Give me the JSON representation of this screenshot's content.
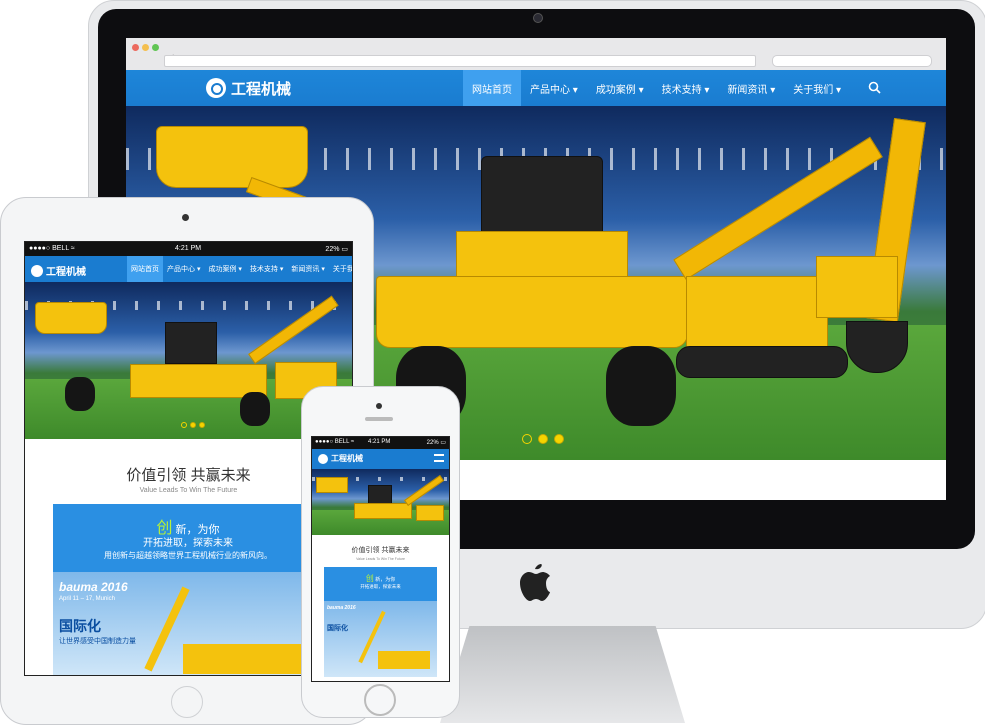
{
  "desktop": {
    "logo_text": "工程机械",
    "nav": [
      {
        "label": "网站首页",
        "active": true
      },
      {
        "label": "产品中心 ▾",
        "active": false
      },
      {
        "label": "成功案例 ▾",
        "active": false
      },
      {
        "label": "技术支持 ▾",
        "active": false
      },
      {
        "label": "新闻资讯 ▾",
        "active": false
      },
      {
        "label": "关于我们 ▾",
        "active": false
      }
    ],
    "carousel": {
      "count": 3,
      "active_index": 0
    },
    "colors": {
      "brand_blue": "#1a7cd0",
      "active_blue": "#3fa0ef",
      "machine_yellow": "#f4c20d"
    }
  },
  "tablet": {
    "status": {
      "carrier": "●●●●○ BELL ≈",
      "time": "4:21 PM",
      "battery": "22% ▭"
    },
    "logo_text": "工程机械",
    "nav": [
      "网站首页",
      "产品中心 ▾",
      "成功案例 ▾",
      "技术支持 ▾",
      "新闻资讯 ▾",
      "关于我们 ▾"
    ],
    "slogan": "价值引领 共赢未来",
    "slogan_sub": "Value Leads To Win The Future",
    "promo": {
      "char": "创",
      "line1": "新，为你",
      "line2": "开拓进取，探索未来",
      "line3": "用创新与超越领略世界工程机械行业的新风向。",
      "bauma": "bauma 2016",
      "bauma_date": "April 11 – 17, Munich",
      "intl": "国际化",
      "intl_sub": "让世界感受中国制造力量"
    }
  },
  "phone": {
    "status": {
      "carrier": "●●●●○ BELL ≈",
      "time": "4:21 PM",
      "battery": "22% ▭"
    },
    "logo_text": "工程机械",
    "slogan": "价值引领 共赢未来",
    "slogan_sub": "Value Leads To Win The Future",
    "promo": {
      "char": "创",
      "line1": "新，为你",
      "line2": "开拓进取，探索未来"
    }
  }
}
